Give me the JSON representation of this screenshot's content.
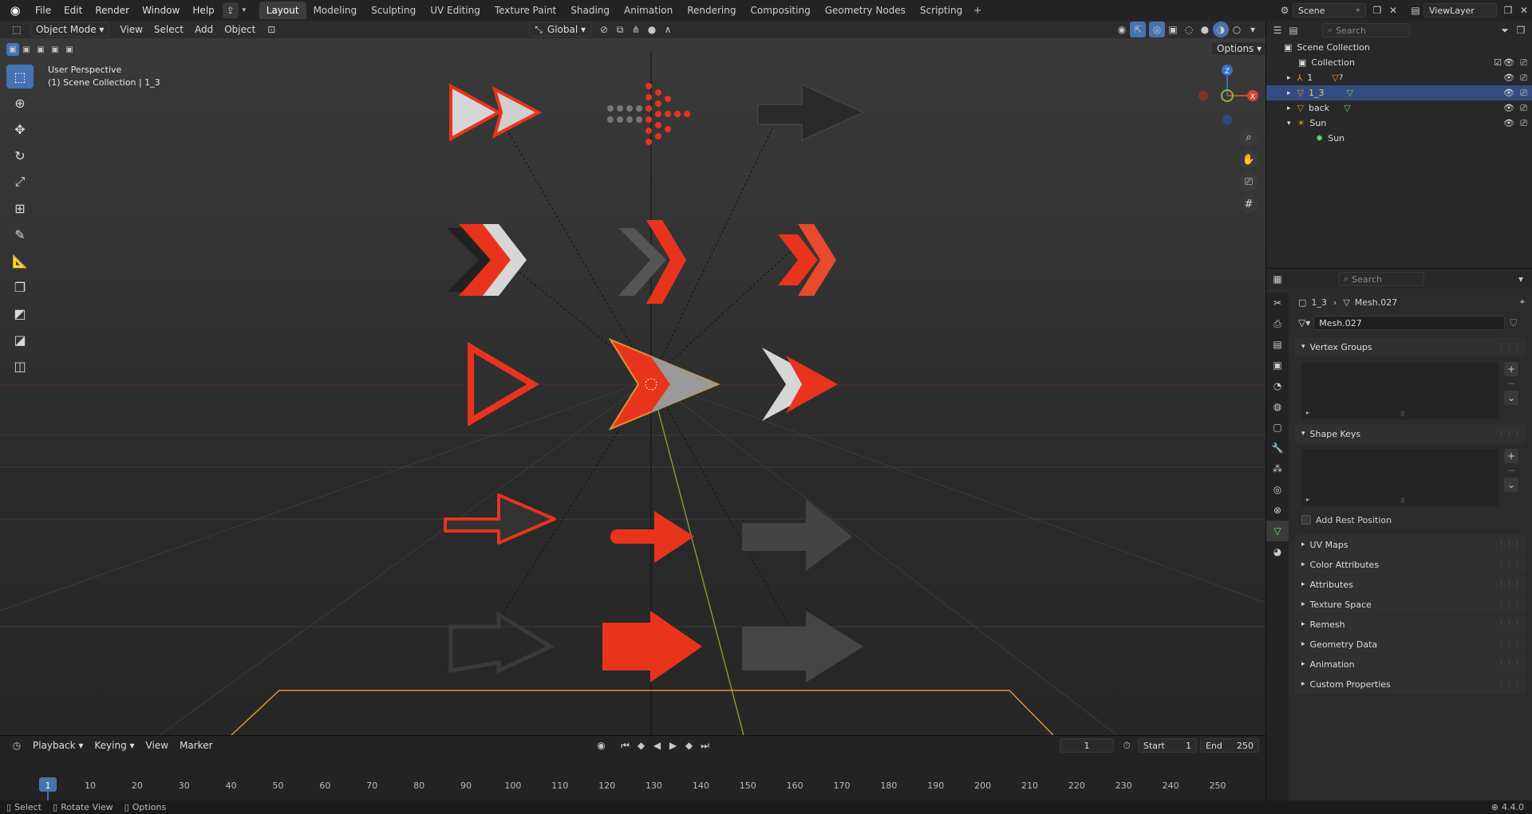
{
  "topbar": {
    "menus": [
      "File",
      "Edit",
      "Render",
      "Window",
      "Help"
    ],
    "workspaces": [
      "Layout",
      "Modeling",
      "Sculpting",
      "UV Editing",
      "Texture Paint",
      "Shading",
      "Animation",
      "Rendering",
      "Compositing",
      "Geometry Nodes",
      "Scripting"
    ],
    "active_workspace": "Layout",
    "scene_name": "Scene",
    "view_layer": "ViewLayer"
  },
  "viewport": {
    "mode": "Object Mode",
    "menus": [
      "View",
      "Select",
      "Add",
      "Object"
    ],
    "orientation": "Global",
    "options_label": "Options",
    "overlay_title": "User Perspective",
    "overlay_subtitle": "(1) Scene Collection | 1_3",
    "axis_labels": {
      "z": "Z",
      "x": "X"
    }
  },
  "timeline": {
    "menus": [
      "Playback",
      "Keying",
      "View",
      "Marker"
    ],
    "current_frame": "1",
    "start_label": "Start",
    "start_value": "1",
    "end_label": "End",
    "end_value": "250",
    "ruler": [
      "1",
      "10",
      "20",
      "30",
      "40",
      "50",
      "60",
      "70",
      "80",
      "90",
      "100",
      "110",
      "120",
      "130",
      "140",
      "150",
      "160",
      "170",
      "180",
      "190",
      "200",
      "210",
      "220",
      "230",
      "240",
      "250"
    ]
  },
  "outliner": {
    "search_placeholder": "Search",
    "root": "Scene Collection",
    "collection": "Collection",
    "items": [
      {
        "name": "1",
        "extra": "7"
      },
      {
        "name": "1_3",
        "extra": ""
      },
      {
        "name": "back",
        "extra": ""
      },
      {
        "name": "Sun",
        "extra": ""
      }
    ],
    "sun_child": "Sun"
  },
  "properties": {
    "search_placeholder": "Search",
    "breadcrumb_object": "1_3",
    "breadcrumb_mesh": "Mesh.027",
    "mesh_name": "Mesh.027",
    "panel_vertex_groups": "Vertex Groups",
    "panel_shape_keys": "Shape Keys",
    "add_rest_position": "Add Rest Position",
    "collapsed_panels": [
      "UV Maps",
      "Color Attributes",
      "Attributes",
      "Texture Space",
      "Remesh",
      "Geometry Data",
      "Animation",
      "Custom Properties"
    ]
  },
  "statusbar": {
    "select": "Select",
    "rotate": "Rotate View",
    "options": "Options",
    "version": "4.4.0"
  },
  "colors": {
    "accent_blue": "#4772b3",
    "arrow_red": "#e8341c",
    "selection_orange": "#e8922a"
  }
}
